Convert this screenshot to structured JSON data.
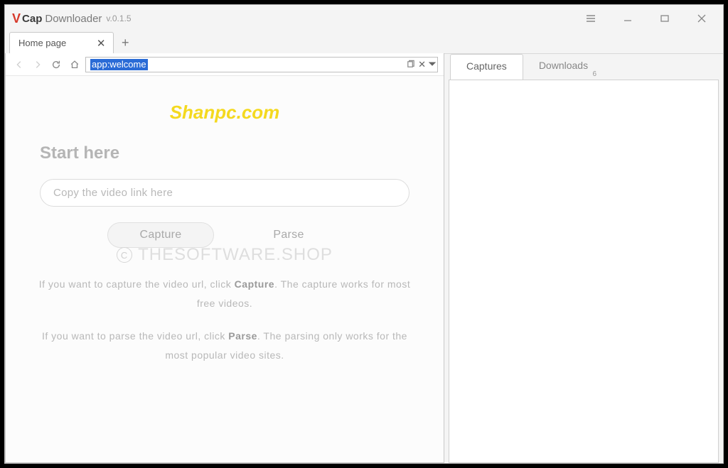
{
  "app": {
    "logo_v": "V",
    "logo_cap": "Cap",
    "logo_dl": "Downloader",
    "version": "v.0.1.5"
  },
  "tabs": {
    "home": "Home page"
  },
  "nav": {
    "address": "app:welcome"
  },
  "welcome": {
    "brand_watermark": "Shanpc.com",
    "heading": "Start here",
    "placeholder": "Copy the video link here",
    "capture_btn": "Capture",
    "parse_btn": "Parse",
    "help1_pre": "If you want to capture the video url, click ",
    "help1_bold": "Capture",
    "help1_post": ". The capture works for most free videos.",
    "help2_pre": "If you want to parse the video url, click ",
    "help2_bold": "Parse",
    "help2_post": ". The parsing only works for the most popular video sites.",
    "shop_watermark": "THESOFTWARE.SHOP"
  },
  "side": {
    "tab_captures": "Captures",
    "tab_downloads": "Downloads",
    "downloads_count": "6"
  }
}
